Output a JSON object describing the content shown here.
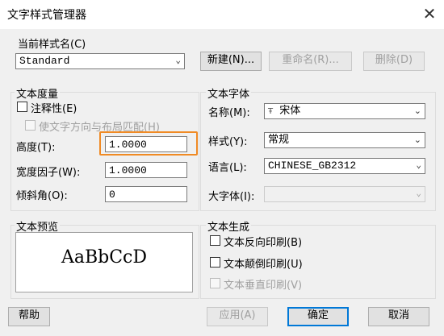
{
  "window": {
    "title": "文字样式管理器",
    "close_glyph": "✕"
  },
  "current_style": {
    "group_label": "当前样式名(C)",
    "selected": "Standard",
    "new_button": "新建(N)...",
    "rename_button": "重命名(R)...",
    "delete_button": "删除(D)"
  },
  "text_metrics": {
    "group_label": "文本度量",
    "annotative_label": "注释性(E)",
    "match_layout_label": "使文字方向与布局匹配(H)",
    "height_label": "高度(T):",
    "height_value": "1.0000",
    "width_factor_label": "宽度因子(W):",
    "width_factor_value": "1.0000",
    "oblique_label": "倾斜角(O):",
    "oblique_value": "0"
  },
  "text_font": {
    "group_label": "文本字体",
    "name_label": "名称(M):",
    "name_value": "宋体",
    "name_icon_glyph": "Ŧ",
    "style_label": "样式(Y):",
    "style_value": "常规",
    "language_label": "语言(L):",
    "language_value": "CHINESE_GB2312",
    "bigfont_label": "大字体(I):",
    "bigfont_value": ""
  },
  "preview": {
    "group_label": "文本预览",
    "sample": "AaBbCcD"
  },
  "text_generation": {
    "group_label": "文本生成",
    "backwards_label": "文本反向印刷(B)",
    "upside_down_label": "文本颠倒印刷(U)",
    "vertical_label": "文本垂直印刷(V)"
  },
  "footer": {
    "help_button": "帮助",
    "apply_button": "应用(A)",
    "ok_button": "确定",
    "cancel_button": "取消"
  },
  "colors": {
    "highlight": "#f08a24",
    "focus_border": "#0078d7"
  }
}
